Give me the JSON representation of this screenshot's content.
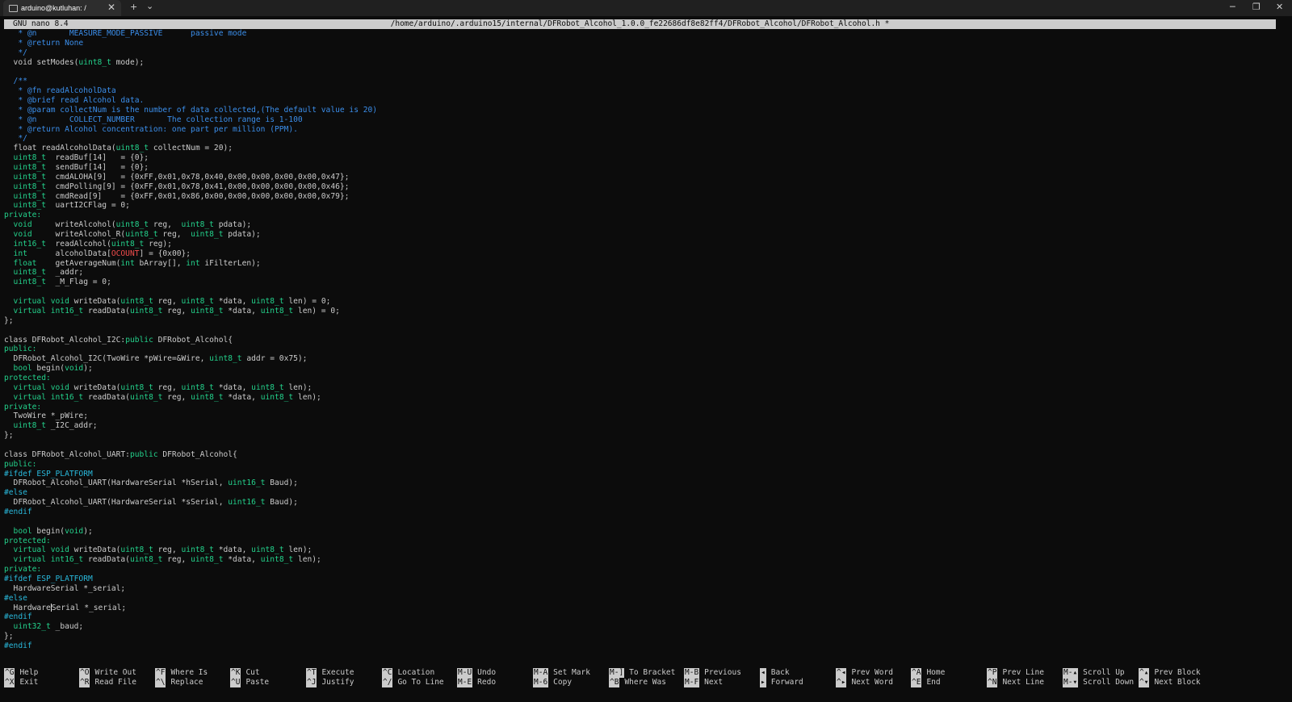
{
  "window": {
    "tab_title": "arduino@kutluhan: /",
    "new_tab_symbol": "+",
    "dropdown_symbol": "⌄",
    "close_symbol": "✕",
    "controls": {
      "minimize": "─",
      "maximize": "❐",
      "close": "✕"
    }
  },
  "nano": {
    "version": "GNU nano 8.4",
    "path": "/home/arduino/.arduino15/internal/DFRobot_Alcohol_1.0.0_fe22686df8e82ff4/DFRobot_Alcohol/DFRobot_Alcohol.h *"
  },
  "colors": {
    "background": "#0c0c0c",
    "text": "#cccccc",
    "comment": "#3b8eea",
    "type": "#23d18b",
    "macro": "#f14c4c",
    "preprocessor": "#29b8db"
  },
  "code_lines": [
    [
      [
        "c",
        "   * @n       MEASURE_MODE_PASSIVE      passive mode"
      ]
    ],
    [
      [
        "c",
        "   * @return None"
      ]
    ],
    [
      [
        "c",
        "   */"
      ]
    ],
    [
      [
        "",
        "  void setModes("
      ],
      [
        "t",
        "uint8_t"
      ],
      [
        "",
        " mode);"
      ]
    ],
    [
      [
        "",
        ""
      ]
    ],
    [
      [
        "c",
        "  /**"
      ]
    ],
    [
      [
        "c",
        "   * @fn readAlcoholData"
      ]
    ],
    [
      [
        "c",
        "   * @brief read Alcohol data."
      ]
    ],
    [
      [
        "c",
        "   * @param collectNum is the number of data collected,(The default value is 20)"
      ]
    ],
    [
      [
        "c",
        "   * @n       COLLECT_NUMBER       The collection range is 1-100"
      ]
    ],
    [
      [
        "c",
        "   * @return Alcohol concentration: one part per million (PPM)."
      ]
    ],
    [
      [
        "c",
        "   */"
      ]
    ],
    [
      [
        "",
        "  float readAlcoholData("
      ],
      [
        "t",
        "uint8_t"
      ],
      [
        "",
        " collectNum = 20);"
      ]
    ],
    [
      [
        "t",
        "  uint8_t"
      ],
      [
        "",
        "  readBuf[14]   = {0};"
      ]
    ],
    [
      [
        "t",
        "  uint8_t"
      ],
      [
        "",
        "  sendBuf[14]   = {0};"
      ]
    ],
    [
      [
        "t",
        "  uint8_t"
      ],
      [
        "",
        "  cmdALOHA[9]   = {0xFF,0x01,0x78,0x40,0x00,0x00,0x00,0x00,0x47};"
      ]
    ],
    [
      [
        "t",
        "  uint8_t"
      ],
      [
        "",
        "  cmdPolling[9] = {0xFF,0x01,0x78,0x41,0x00,0x00,0x00,0x00,0x46};"
      ]
    ],
    [
      [
        "t",
        "  uint8_t"
      ],
      [
        "",
        "  cmdRead[9]    = {0xFF,0x01,0x86,0x00,0x00,0x00,0x00,0x00,0x79};"
      ]
    ],
    [
      [
        "t",
        "  uint8_t"
      ],
      [
        "",
        "  uartI2CFlag = 0;"
      ]
    ],
    [
      [
        "t",
        "private:"
      ]
    ],
    [
      [
        "t",
        "  void"
      ],
      [
        "",
        "     writeAlcohol("
      ],
      [
        "t",
        "uint8_t"
      ],
      [
        "",
        " reg,  "
      ],
      [
        "t",
        "uint8_t"
      ],
      [
        "",
        " pdata);"
      ]
    ],
    [
      [
        "t",
        "  void"
      ],
      [
        "",
        "     writeAlcohol_R("
      ],
      [
        "t",
        "uint8_t"
      ],
      [
        "",
        " reg,  "
      ],
      [
        "t",
        "uint8_t"
      ],
      [
        "",
        " pdata);"
      ]
    ],
    [
      [
        "t",
        "  int16_t"
      ],
      [
        "",
        "  readAlcohol("
      ],
      [
        "t",
        "uint8_t"
      ],
      [
        "",
        " reg);"
      ]
    ],
    [
      [
        "t",
        "  int"
      ],
      [
        "",
        "      alcoholData["
      ],
      [
        "m",
        "OCOUNT"
      ],
      [
        "",
        "] = {0x00};"
      ]
    ],
    [
      [
        "t",
        "  float"
      ],
      [
        "",
        "    getAverageNum("
      ],
      [
        "t",
        "int"
      ],
      [
        "",
        " bArray[], "
      ],
      [
        "t",
        "int"
      ],
      [
        "",
        " iFilterLen);"
      ]
    ],
    [
      [
        "t",
        "  uint8_t"
      ],
      [
        "",
        "  _addr;"
      ]
    ],
    [
      [
        "t",
        "  uint8_t"
      ],
      [
        "",
        "  _M_Flag = 0;"
      ]
    ],
    [
      [
        "",
        ""
      ]
    ],
    [
      [
        "t",
        "  virtual void"
      ],
      [
        "",
        " writeData("
      ],
      [
        "t",
        "uint8_t"
      ],
      [
        "",
        " reg, "
      ],
      [
        "t",
        "uint8_t"
      ],
      [
        "",
        " *data, "
      ],
      [
        "t",
        "uint8_t"
      ],
      [
        "",
        " len) = 0;"
      ]
    ],
    [
      [
        "t",
        "  virtual int16_t"
      ],
      [
        "",
        " readData("
      ],
      [
        "t",
        "uint8_t"
      ],
      [
        "",
        " reg, "
      ],
      [
        "t",
        "uint8_t"
      ],
      [
        "",
        " *data, "
      ],
      [
        "t",
        "uint8_t"
      ],
      [
        "",
        " len) = 0;"
      ]
    ],
    [
      [
        "",
        "};"
      ]
    ],
    [
      [
        "",
        ""
      ]
    ],
    [
      [
        "",
        "class DFRobot_Alcohol_I2C:"
      ],
      [
        "t",
        "public"
      ],
      [
        "",
        " DFRobot_Alcohol{"
      ]
    ],
    [
      [
        "t",
        "public:"
      ]
    ],
    [
      [
        "",
        "  DFRobot_Alcohol_I2C(TwoWire *pWire=&Wire, "
      ],
      [
        "t",
        "uint8_t"
      ],
      [
        "",
        " addr = 0x75);"
      ]
    ],
    [
      [
        "t",
        "  bool"
      ],
      [
        "",
        " begin("
      ],
      [
        "t",
        "void"
      ],
      [
        "",
        ");"
      ]
    ],
    [
      [
        "t",
        "protected:"
      ]
    ],
    [
      [
        "t",
        "  virtual void"
      ],
      [
        "",
        " writeData("
      ],
      [
        "t",
        "uint8_t"
      ],
      [
        "",
        " reg, "
      ],
      [
        "t",
        "uint8_t"
      ],
      [
        "",
        " *data, "
      ],
      [
        "t",
        "uint8_t"
      ],
      [
        "",
        " len);"
      ]
    ],
    [
      [
        "t",
        "  virtual int16_t"
      ],
      [
        "",
        " readData("
      ],
      [
        "t",
        "uint8_t"
      ],
      [
        "",
        " reg, "
      ],
      [
        "t",
        "uint8_t"
      ],
      [
        "",
        " *data, "
      ],
      [
        "t",
        "uint8_t"
      ],
      [
        "",
        " len);"
      ]
    ],
    [
      [
        "t",
        "private:"
      ]
    ],
    [
      [
        "",
        "  TwoWire *_pWire;"
      ]
    ],
    [
      [
        "t",
        "  uint8_t"
      ],
      [
        "",
        " _I2C_addr;"
      ]
    ],
    [
      [
        "",
        "};"
      ]
    ],
    [
      [
        "",
        ""
      ]
    ],
    [
      [
        "",
        "class DFRobot_Alcohol_UART:"
      ],
      [
        "t",
        "public"
      ],
      [
        "",
        " DFRobot_Alcohol{"
      ]
    ],
    [
      [
        "t",
        "public:"
      ]
    ],
    [
      [
        "p",
        "#ifdef ESP_PLATFORM"
      ]
    ],
    [
      [
        "",
        "  DFRobot_Alcohol_UART(HardwareSerial *hSerial, "
      ],
      [
        "t",
        "uint16_t"
      ],
      [
        "",
        " Baud);"
      ]
    ],
    [
      [
        "p",
        "#else"
      ]
    ],
    [
      [
        "",
        "  DFRobot_Alcohol_UART(HardwareSerial *sSerial, "
      ],
      [
        "t",
        "uint16_t"
      ],
      [
        "",
        " Baud);"
      ]
    ],
    [
      [
        "p",
        "#endif"
      ]
    ],
    [
      [
        "",
        ""
      ]
    ],
    [
      [
        "t",
        "  bool"
      ],
      [
        "",
        " begin("
      ],
      [
        "t",
        "void"
      ],
      [
        "",
        ");"
      ]
    ],
    [
      [
        "t",
        "protected:"
      ]
    ],
    [
      [
        "t",
        "  virtual void"
      ],
      [
        "",
        " writeData("
      ],
      [
        "t",
        "uint8_t"
      ],
      [
        "",
        " reg, "
      ],
      [
        "t",
        "uint8_t"
      ],
      [
        "",
        " *data, "
      ],
      [
        "t",
        "uint8_t"
      ],
      [
        "",
        " len);"
      ]
    ],
    [
      [
        "t",
        "  virtual int16_t"
      ],
      [
        "",
        " readData("
      ],
      [
        "t",
        "uint8_t"
      ],
      [
        "",
        " reg, "
      ],
      [
        "t",
        "uint8_t"
      ],
      [
        "",
        " *data, "
      ],
      [
        "t",
        "uint8_t"
      ],
      [
        "",
        " len);"
      ]
    ],
    [
      [
        "t",
        "private:"
      ]
    ],
    [
      [
        "p",
        "#ifdef ESP_PLATFORM"
      ]
    ],
    [
      [
        "",
        "  HardwareSerial *_serial;"
      ]
    ],
    [
      [
        "p",
        "#else"
      ]
    ],
    [
      [
        "",
        "  Hardware"
      ],
      [
        "cursor",
        ""
      ],
      [
        "",
        "Serial *_serial;"
      ]
    ],
    [
      [
        "p",
        "#endif"
      ]
    ],
    [
      [
        "t",
        "  uint32_t"
      ],
      [
        "",
        " _baud;"
      ]
    ],
    [
      [
        "",
        "};"
      ]
    ],
    [
      [
        "p",
        "#endif"
      ]
    ]
  ],
  "shortcuts": [
    {
      "key": "^G",
      "label": "Help"
    },
    {
      "key": "^X",
      "label": "Exit"
    },
    {
      "key": "^O",
      "label": "Write Out"
    },
    {
      "key": "^R",
      "label": "Read File"
    },
    {
      "key": "^F",
      "label": "Where Is"
    },
    {
      "key": "^\\",
      "label": "Replace"
    },
    {
      "key": "^K",
      "label": "Cut"
    },
    {
      "key": "^U",
      "label": "Paste"
    },
    {
      "key": "^T",
      "label": "Execute"
    },
    {
      "key": "^J",
      "label": "Justify"
    },
    {
      "key": "^C",
      "label": "Location"
    },
    {
      "key": "^/",
      "label": "Go To Line"
    },
    {
      "key": "M-U",
      "label": "Undo"
    },
    {
      "key": "M-E",
      "label": "Redo"
    },
    {
      "key": "M-A",
      "label": "Set Mark"
    },
    {
      "key": "M-6",
      "label": "Copy"
    },
    {
      "key": "M-]",
      "label": "To Bracket"
    },
    {
      "key": "^B",
      "label": "Where Was"
    },
    {
      "key": "M-B",
      "label": "Previous"
    },
    {
      "key": "M-F",
      "label": "Next"
    },
    {
      "key": "◂",
      "label": "Back"
    },
    {
      "key": "▸",
      "label": "Forward"
    },
    {
      "key": "^◂",
      "label": "Prev Word"
    },
    {
      "key": "^▸",
      "label": "Next Word"
    },
    {
      "key": "^A",
      "label": "Home"
    },
    {
      "key": "^E",
      "label": "End"
    },
    {
      "key": "^P",
      "label": "Prev Line"
    },
    {
      "key": "^N",
      "label": "Next Line"
    },
    {
      "key": "M-▴",
      "label": "Scroll Up"
    },
    {
      "key": "M-▾",
      "label": "Scroll Down"
    },
    {
      "key": "^▴",
      "label": "Prev Block"
    },
    {
      "key": "^▾",
      "label": "Next Block"
    }
  ]
}
